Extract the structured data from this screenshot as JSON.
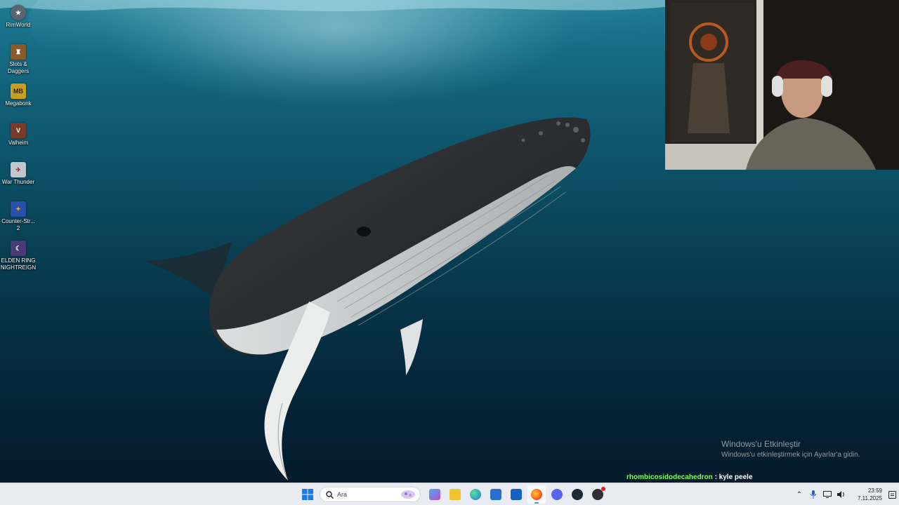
{
  "desktop": {
    "icons": [
      {
        "label": "RimWorld",
        "icon": "rimworld-icon",
        "color": "#5a6470"
      },
      {
        "label": "Slots & Daggers",
        "icon": "slots-and-daggers-icon",
        "color": "#8a5a2a"
      },
      {
        "label": "Megabonk",
        "icon": "megabonk-icon",
        "color": "#c8a020"
      },
      {
        "label": "Valheim",
        "icon": "valheim-icon",
        "color": "#7a3a2a"
      },
      {
        "label": "War Thunder",
        "icon": "war-thunder-icon",
        "color": "#c0c6cc"
      },
      {
        "label": "Counter-Str... 2",
        "icon": "counter-strike-2-icon",
        "color": "#2a4fa8"
      },
      {
        "label": "ELDEN RING NIGHTREIGN",
        "icon": "elden-ring-nightreign-icon",
        "color": "#4a3a78"
      }
    ]
  },
  "activation": {
    "title": "Windows'u Etkinleştir",
    "subtitle": "Windows'u etkinleştirmek için Ayarlar'a gidin."
  },
  "chat": {
    "username": "rhombicosidodecahedron",
    "separator": " : ",
    "message": "kyle peele",
    "username_color": "#7cff5a"
  },
  "taskbar": {
    "search_placeholder": "Ara",
    "apps": [
      {
        "name": "widgets",
        "icon": "widgets-icon"
      },
      {
        "name": "file-explorer",
        "icon": "folder-icon"
      },
      {
        "name": "edge",
        "icon": "edge-icon"
      },
      {
        "name": "store",
        "icon": "store-icon"
      },
      {
        "name": "outlook",
        "icon": "outlook-icon"
      },
      {
        "name": "firefox",
        "icon": "firefox-icon"
      },
      {
        "name": "discord",
        "icon": "discord-icon"
      },
      {
        "name": "steam",
        "icon": "steam-icon"
      },
      {
        "name": "obs",
        "icon": "obs-icon"
      }
    ],
    "clock_time": "23:59",
    "clock_date": "7.11.2025"
  }
}
